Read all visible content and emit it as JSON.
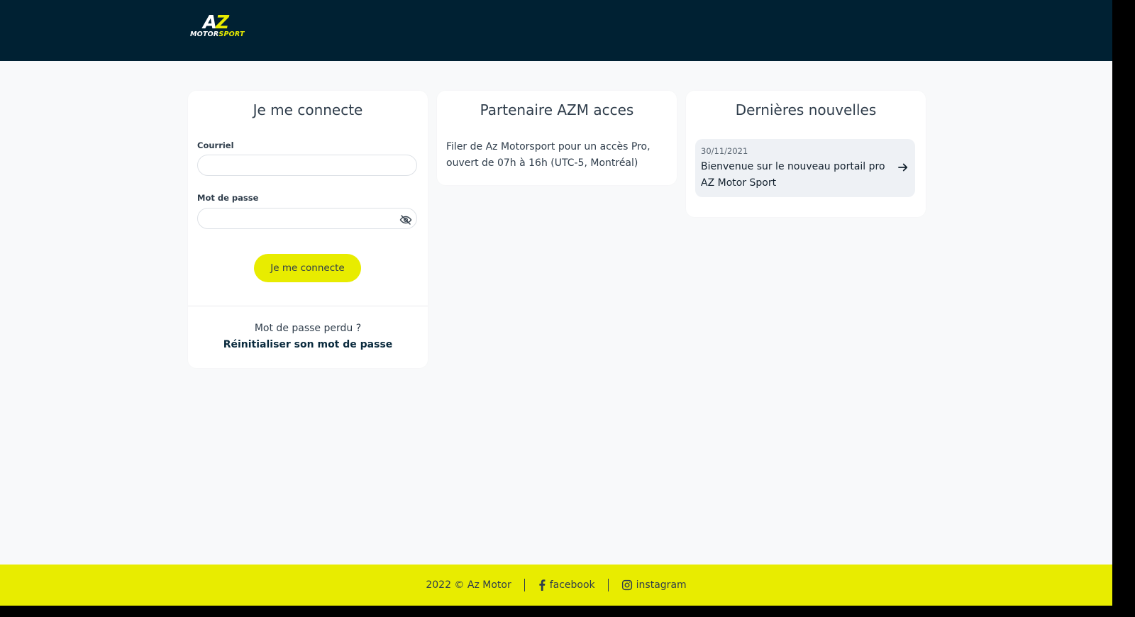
{
  "header": {
    "logo_letters_a": "A",
    "logo_letters_z": "Z",
    "logo_word_motor": "MOTOR",
    "logo_word_sport": "SPORT"
  },
  "login": {
    "title": "Je me connecte",
    "email_label": "Courriel",
    "email_value": "",
    "password_label": "Mot de passe",
    "password_value": "",
    "submit_label": "Je me connecte",
    "lost_text": "Mot de passe perdu ?",
    "reset_link": "Réinitialiser son mot de passe"
  },
  "partner": {
    "title": "Partenaire AZM acces",
    "text": "Filer de Az Motorsport pour un accès Pro, ouvert de 07h à 16h (UTC-5, Montréal)"
  },
  "news": {
    "title": "Dernières nouvelles",
    "items": [
      {
        "date": "30/11/2021",
        "title": "Bienvenue sur le nouveau portail pro AZ Motor Sport"
      }
    ]
  },
  "footer": {
    "copyright": "2022 © Az Motor",
    "facebook": "facebook",
    "instagram": "instagram"
  },
  "colors": {
    "header_bg": "#002133",
    "accent_yellow": "#e8ec00",
    "page_bg": "#f8f9fa",
    "text": "#2f3d4b"
  },
  "icons": [
    "eye-slash-icon",
    "arrow-right-icon",
    "facebook-icon",
    "instagram-icon"
  ]
}
